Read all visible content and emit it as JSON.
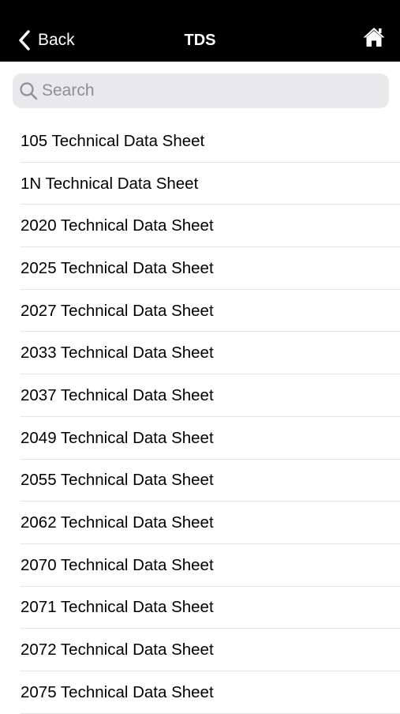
{
  "navbar": {
    "back_label": "Back",
    "title": "TDS",
    "home_icon": "home-icon",
    "background": "#000000"
  },
  "search": {
    "placeholder": "Search",
    "value": ""
  },
  "list": {
    "items": [
      {
        "label": "105 Technical Data Sheet"
      },
      {
        "label": "1N Technical Data Sheet"
      },
      {
        "label": "2020 Technical Data Sheet"
      },
      {
        "label": "2025 Technical Data Sheet"
      },
      {
        "label": "2027 Technical Data Sheet"
      },
      {
        "label": "2033 Technical Data Sheet"
      },
      {
        "label": "2037 Technical Data Sheet"
      },
      {
        "label": "2049 Technical Data Sheet"
      },
      {
        "label": "2055 Technical Data Sheet"
      },
      {
        "label": "2062 Technical Data Sheet"
      },
      {
        "label": "2070 Technical Data Sheet"
      },
      {
        "label": "2071 Technical Data Sheet"
      },
      {
        "label": "2072 Technical Data Sheet"
      },
      {
        "label": "2075 Technical Data Sheet"
      }
    ]
  }
}
